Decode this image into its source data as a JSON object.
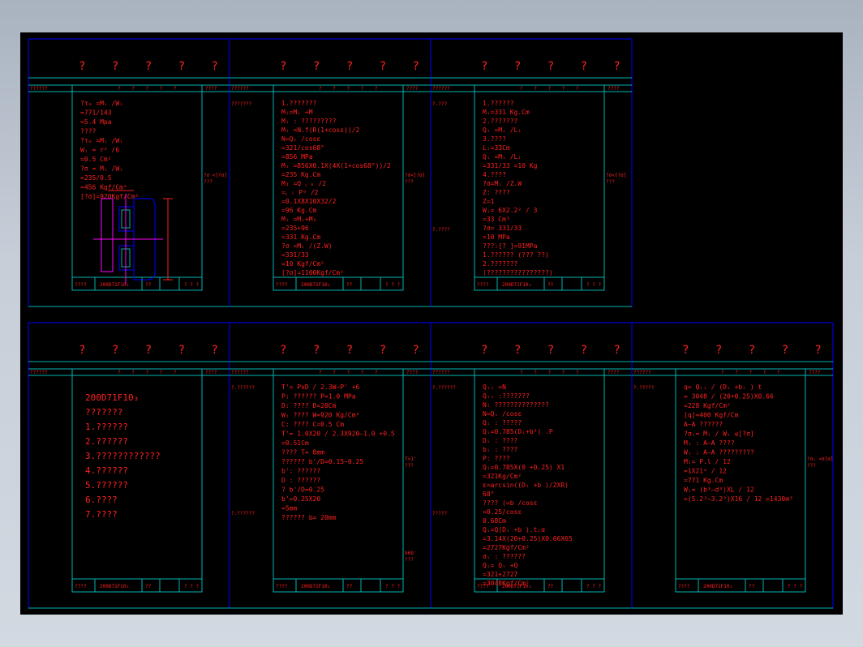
{
  "sheets": [
    {
      "title": "? ? ? ? ?",
      "header": {
        "left": "??????",
        "mid": "? ? ? ? ?",
        "right": "????"
      },
      "side_left": [
        ""
      ],
      "side_right": [
        "?σ <[?σ]",
        "???"
      ],
      "lines": [
        "?τₘ =Mᵢ /Wᵢ",
        "=771/143",
        "≈5.4 Mpa",
        "????",
        "?τₘ =Mᵢ /Wᵢ",
        "Wᵢ = r² /6",
        "=0.5 Cm²",
        "?σ = Mᵢ /Wᵢ",
        "≈235/0.5",
        "=456 Kgf/Cm²",
        "[?σ]=920Kgf/Cm²"
      ],
      "title_block": {
        "a": "????",
        "b": "200D71F10₃",
        "c": "??",
        "d": "? ? ?"
      }
    },
    {
      "title": "? ? ? ? ?",
      "header": {
        "left": "??????",
        "mid": "? ? ? ? ?",
        "right": "????"
      },
      "side_left": [
        "???????"
      ],
      "side_right": [
        "?σ<[?σ]",
        "???"
      ],
      "lines": [
        "1.???????",
        "Mᵢ=Mᵢ +M",
        "Mᵢ : ?????????",
        "Mᵢ =N.f(R(1+cosε))/2",
        "N=Qᵢ /cosε",
        "=321/cos68°",
        "=856 MPa",
        "Mᵢ =856X0.1X(4X(1+cos68°))/2",
        "=235 Kg.Cm",
        "M₁ =Q ᵧ ₖ /2",
        "=ᵧ ₗ Pᵃ /2",
        "=0.1X8X10X32/2",
        "=96 Kg.Cm",
        "Mᵢ =Mᵢ+M₁",
        "=235+96",
        "=331 Kg.Cm",
        "?σ =Mᵢ /(Z.W)",
        "=331/33",
        "=10 Kgf/Cm²",
        "[?σ]=1100Kgf/Cm²"
      ],
      "title_block": {
        "a": "????",
        "b": "200D71F10₃",
        "c": "??",
        "d": "? ? ?"
      }
    },
    {
      "title": "? ? ? ? ?",
      "header": {
        "left": "??????",
        "mid": "? ? ? ? ?",
        "right": "????"
      },
      "side_left": [
        "?.???",
        "?.????"
      ],
      "side_right": [
        "?σ<[?σ]",
        "???"
      ],
      "lines": [
        "1.??????",
        "Mᵢ=331 Kg.Cm",
        "2.???????",
        "Qᵢ =Mᵢ /Lᵢ",
        "3.????",
        "Lᵢ=33Cm",
        "Qᵢ =Mᵢ /Lᵢ",
        "=331/33 =10 Kg",
        "4.????",
        "?σ=Mᵢ /Z.W",
        "Z: ????",
        "Z=1",
        "Wᵢ= 6X2.2² / 3",
        "=33 Cm³",
        "?σ= 331/33",
        "=10 MPa",
        "???:[? ]=91MPa",
        "1.?????? (??? ??)",
        "2.???????",
        "(????????????????)"
      ],
      "title_block": {
        "a": "????",
        "b": "200D71F10₃",
        "c": "??",
        "d": "? ? ?"
      }
    },
    {
      "title": "? ? ? ? ?",
      "header": {
        "left": "??????",
        "mid": "? ? ? ? ?",
        "right": "????"
      },
      "side_left": [
        ""
      ],
      "side_right": [
        ""
      ],
      "lines": [
        "200D71F10₃",
        "???????",
        "1.??????",
        "2.??????",
        "3.????????????",
        "4.??????",
        "5.??????",
        "6.????",
        "7.????"
      ],
      "title_block": {
        "a": "????",
        "b": "200D71F10₃",
        "c": "??",
        "d": "? ? ?"
      }
    },
    {
      "title": "? ? ? ? ?",
      "header": {
        "left": "??????",
        "mid": "? ? ? ? ?",
        "right": "????"
      },
      "side_left": [
        "?.??????",
        "?.??????"
      ],
      "side_right": [
        "T>1'",
        "???",
        "b6b'",
        "???"
      ],
      "lines": [
        "T'= PxD / 2.3W–P' +6",
        "P: ?????? P=1.0 MPa",
        "D: ????    D=20Cm",
        "Wᵢ ????    W=920 Kg/Cm²",
        "C: ????    C=0.5 Cm",
        "T'= 1.0X20 / 2.3X920–1.0 +0.5",
        "=0.51Cm",
        "???? T=   8mm",
        "?????? b'/D=0.15~0.25",
        "b': ??????",
        "D : ??????",
        "? b'/D=0.25",
        "b'=0.25X20",
        "=5mm",
        "?????? b=    20mm"
      ],
      "title_block": {
        "a": "????",
        "b": "200D71F10₃",
        "c": "??",
        "d": "? ? ?"
      }
    },
    {
      "title": "? ? ? ? ?",
      "header": {
        "left": "??????",
        "mid": "? ? ? ? ?",
        "right": "????"
      },
      "side_left": [
        "?.??????",
        "?????"
      ],
      "side_right": [
        ""
      ],
      "lines": [
        "Qᵢᵢ =N",
        "Qᵢᵢ :???????",
        "N: ??????????????",
        "N=Qᵢ /cosε",
        "Qᵢ : ?????",
        "Qᵢ=0.785(Dᵢ+b²) .P",
        "Dᵢ : ????",
        "bᵢ : ????",
        "P: ????",
        "Qᵢ=0.785X(0 +0.25) X1",
        "=321Kg/Cm²",
        "ε=arcsin((Dᵢ +b )/2XR)",
        "68°",
        "???? (=b /cosε",
        "=0.25/cosε",
        "0.68Cm",
        "Qᵢ=Q(Dᵢ +b ).tᵢα",
        "=3.14X(20+0.25)X0.66X65",
        "=2727Kgf/Cm²",
        "σᵢ : ??????",
        "Qᵢ= Qᵢ +Q",
        "=321+2727",
        "=3048Kgf/Cm²"
      ],
      "title_block": {
        "a": "????",
        "b": "200D71F10₃",
        "c": "??",
        "d": "? ? ?"
      }
    },
    {
      "title": "? ? ? ? ?",
      "header": {
        "left": "??????",
        "mid": "? ? ? ? ?",
        "right": "????"
      },
      "side_left": [
        "?.?????"
      ],
      "side_right": [
        "?σᵢ <σ[σ]",
        "???"
      ],
      "lines": [
        "q= Qᵢᵢ / (Dᵢ +bᵢ ) t",
        "= 3048 / (20+0.25)X0.66",
        "=228 Kgf/Cm²",
        "[q]=400 Kgf/Cm",
        "A–A ??????",
        "?σᵢ= Mᵢ / Wᵢ ≤[?σ]",
        "Mᵢ : A–A ????",
        "Wᵢ : A–A ?????????",
        "Mᵢ= P.l / 12",
        "=1X21² / 12",
        "=771 Kg.Cm",
        "Wᵢ= (b³–d³)XL / 12",
        "=(5.2³–3.2³)X16 / 12 =1430m³"
      ],
      "title_block": {
        "a": "????",
        "b": "200D71F10₃",
        "c": "??",
        "d": "? ? ?"
      }
    }
  ]
}
